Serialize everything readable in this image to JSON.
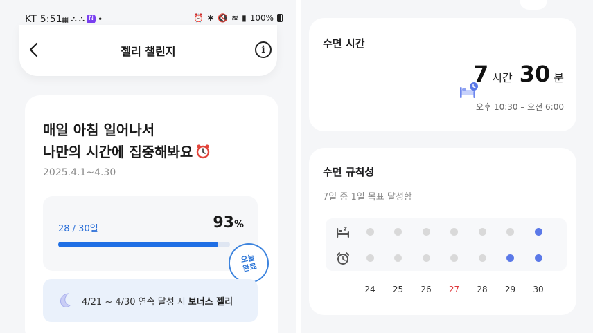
{
  "status_bar": {
    "carrier": "KT",
    "time": "5:51",
    "battery": "100%",
    "notification_badge": "N"
  },
  "left": {
    "header": {
      "title": "젤리 챌린지"
    },
    "challenge": {
      "title_line1": "매일 아침 일어나서",
      "title_line2": "나만의 시간에 집중해봐요",
      "date_range": "2025.4.1~4.30",
      "progress_count": "28 / 30일",
      "progress_percent": "93",
      "progress_unit": "%",
      "progress_fraction": 0.93,
      "today_stamp_line1": "오늘",
      "today_stamp_line2": "완료",
      "bonus_text": "4/21 ~ 4/30 연속 달성 시",
      "bonus_highlight": "보너스 젤리"
    }
  },
  "right": {
    "sleep_time": {
      "title": "수면 시간",
      "hours": "7",
      "hours_unit": "시간",
      "minutes": "30",
      "minutes_unit": "분",
      "range": "오후 10:30 – 오전 6:00"
    },
    "regularity": {
      "title": "수면 규칙성",
      "subtitle": "7일 중 1일 목표 달성함",
      "days": [
        {
          "label": "24",
          "bed": false,
          "wake": false,
          "red": false
        },
        {
          "label": "25",
          "bed": false,
          "wake": false,
          "red": false
        },
        {
          "label": "26",
          "bed": false,
          "wake": false,
          "red": false
        },
        {
          "label": "27",
          "bed": false,
          "wake": false,
          "red": true
        },
        {
          "label": "28",
          "bed": false,
          "wake": false,
          "red": false
        },
        {
          "label": "29",
          "bed": false,
          "wake": true,
          "red": false
        },
        {
          "label": "30",
          "bed": true,
          "wake": true,
          "red": false
        }
      ]
    }
  },
  "colors": {
    "accent_blue": "#1f6fe5",
    "dot_active": "#5b79e8",
    "dot_inactive": "#d9d9d9",
    "weekend_red": "#e0393e"
  },
  "icons": {
    "back": "chevron-left-icon",
    "info": "info-icon",
    "alarm": "alarm-clock-icon",
    "bonus": "jelly-icon",
    "bed": "bed-icon",
    "wake": "alarm-icon"
  }
}
